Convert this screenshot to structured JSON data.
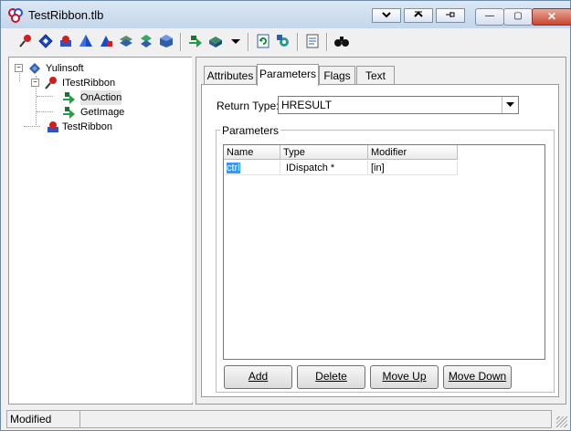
{
  "window": {
    "title": "TestRibbon.tlb",
    "close_glyph": "✕",
    "min_glyph": "—",
    "max_glyph": "▢"
  },
  "toolbar": {
    "icons": [
      "pin-icon",
      "diamond-icon",
      "box-icon",
      "pyramid-icon",
      "shape-icon",
      "layers-icon",
      "stack-icon",
      "cube-icon",
      "arrow-icon",
      "tile-icon",
      "dropdown-icon",
      "refresh-icon",
      "gear-icon",
      "document-icon",
      "binoculars-icon"
    ]
  },
  "tree": {
    "root": "Yulinsoft",
    "interface": "ITestRibbon",
    "method1": "OnAction",
    "method2": "GetImage",
    "coclass": "TestRibbon"
  },
  "tabs": {
    "attributes": "Attributes",
    "parameters": "Parameters",
    "flags": "Flags",
    "text": "Text"
  },
  "form": {
    "return_type_label": "Return Type:",
    "return_type_value": "HRESULT",
    "parameters_group": "Parameters"
  },
  "table": {
    "headers": [
      "Name",
      "Type",
      "Modifier"
    ],
    "rows": [
      [
        "ctrl",
        "IDispatch *",
        "[in]"
      ]
    ]
  },
  "buttons": {
    "add": "Add",
    "delete": "Delete",
    "move_up": "Move Up",
    "move_down": "Move Down"
  },
  "status": {
    "text": "Modified"
  },
  "colors": {
    "selection": "#3399ff",
    "title_gradient_top": "#dbe8f5"
  }
}
